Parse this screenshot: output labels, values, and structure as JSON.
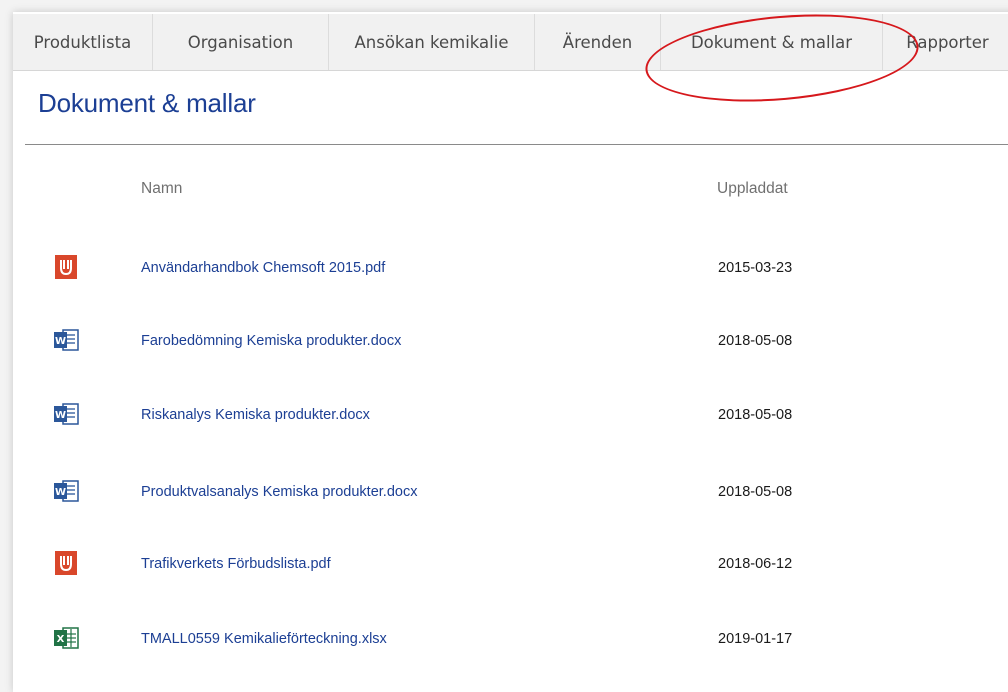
{
  "tabs": [
    {
      "label": "Produktlista"
    },
    {
      "label": "Organisation"
    },
    {
      "label": "Ansökan kemikalie"
    },
    {
      "label": "Ärenden"
    },
    {
      "label": "Dokument & mallar"
    },
    {
      "label": "Rapporter"
    }
  ],
  "page": {
    "title": "Dokument & mallar"
  },
  "table": {
    "columns": {
      "name": "Namn",
      "uploaded": "Uppladdat"
    },
    "rows": [
      {
        "icon": "pdf-icon",
        "name": "Användarhandbok Chemsoft 2015.pdf",
        "uploaded": "2015-03-23"
      },
      {
        "icon": "word-icon",
        "name": "Farobedömning Kemiska produkter.docx",
        "uploaded": "2018-05-08"
      },
      {
        "icon": "word-icon",
        "name": "Riskanalys Kemiska produkter.docx",
        "uploaded": "2018-05-08"
      },
      {
        "icon": "word-icon",
        "name": "Produktvalsanalys Kemiska produkter.docx",
        "uploaded": "2018-05-08"
      },
      {
        "icon": "pdf-icon",
        "name": "Trafikverkets Förbudslista.pdf",
        "uploaded": "2018-06-12"
      },
      {
        "icon": "excel-icon",
        "name": "TMALL0559 Kemikalieförteckning.xlsx",
        "uploaded": "2019-01-17"
      }
    ]
  },
  "colors": {
    "accent_blue": "#1c3f94",
    "highlight_red": "#d6181c",
    "pdf": "#d9472b",
    "word": "#2b579a",
    "excel": "#217346"
  }
}
